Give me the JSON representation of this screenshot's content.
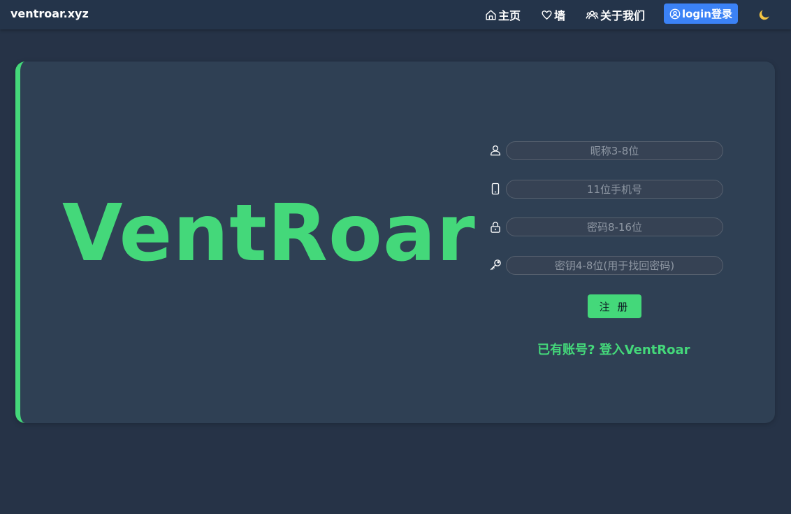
{
  "header": {
    "brand": "ventroar.xyz",
    "nav": {
      "home": "主页",
      "wall": "墙",
      "about": "关于我们",
      "login": "login登录"
    }
  },
  "hero": {
    "title": "VentRoar"
  },
  "form": {
    "nickname_placeholder": "昵称3-8位",
    "phone_placeholder": "11位手机号",
    "password_placeholder": "密码8-16位",
    "key_placeholder": "密钥4-8位(用于找回密码)",
    "register_label": "注 册",
    "login_link": "已有账号? 登入VentRoar"
  },
  "icons": {
    "home": "home-icon",
    "wall": "heart-icon",
    "about": "users-icon",
    "login": "user-circle-icon",
    "theme": "moon-icon",
    "nickname": "user-icon",
    "phone": "phone-icon",
    "password": "lock-icon",
    "key": "key-icon"
  },
  "colors": {
    "background": "#263347",
    "card": "#2f4054",
    "accent": "#44d87a",
    "login_button": "#3b82f6",
    "moon": "#f5c542"
  }
}
